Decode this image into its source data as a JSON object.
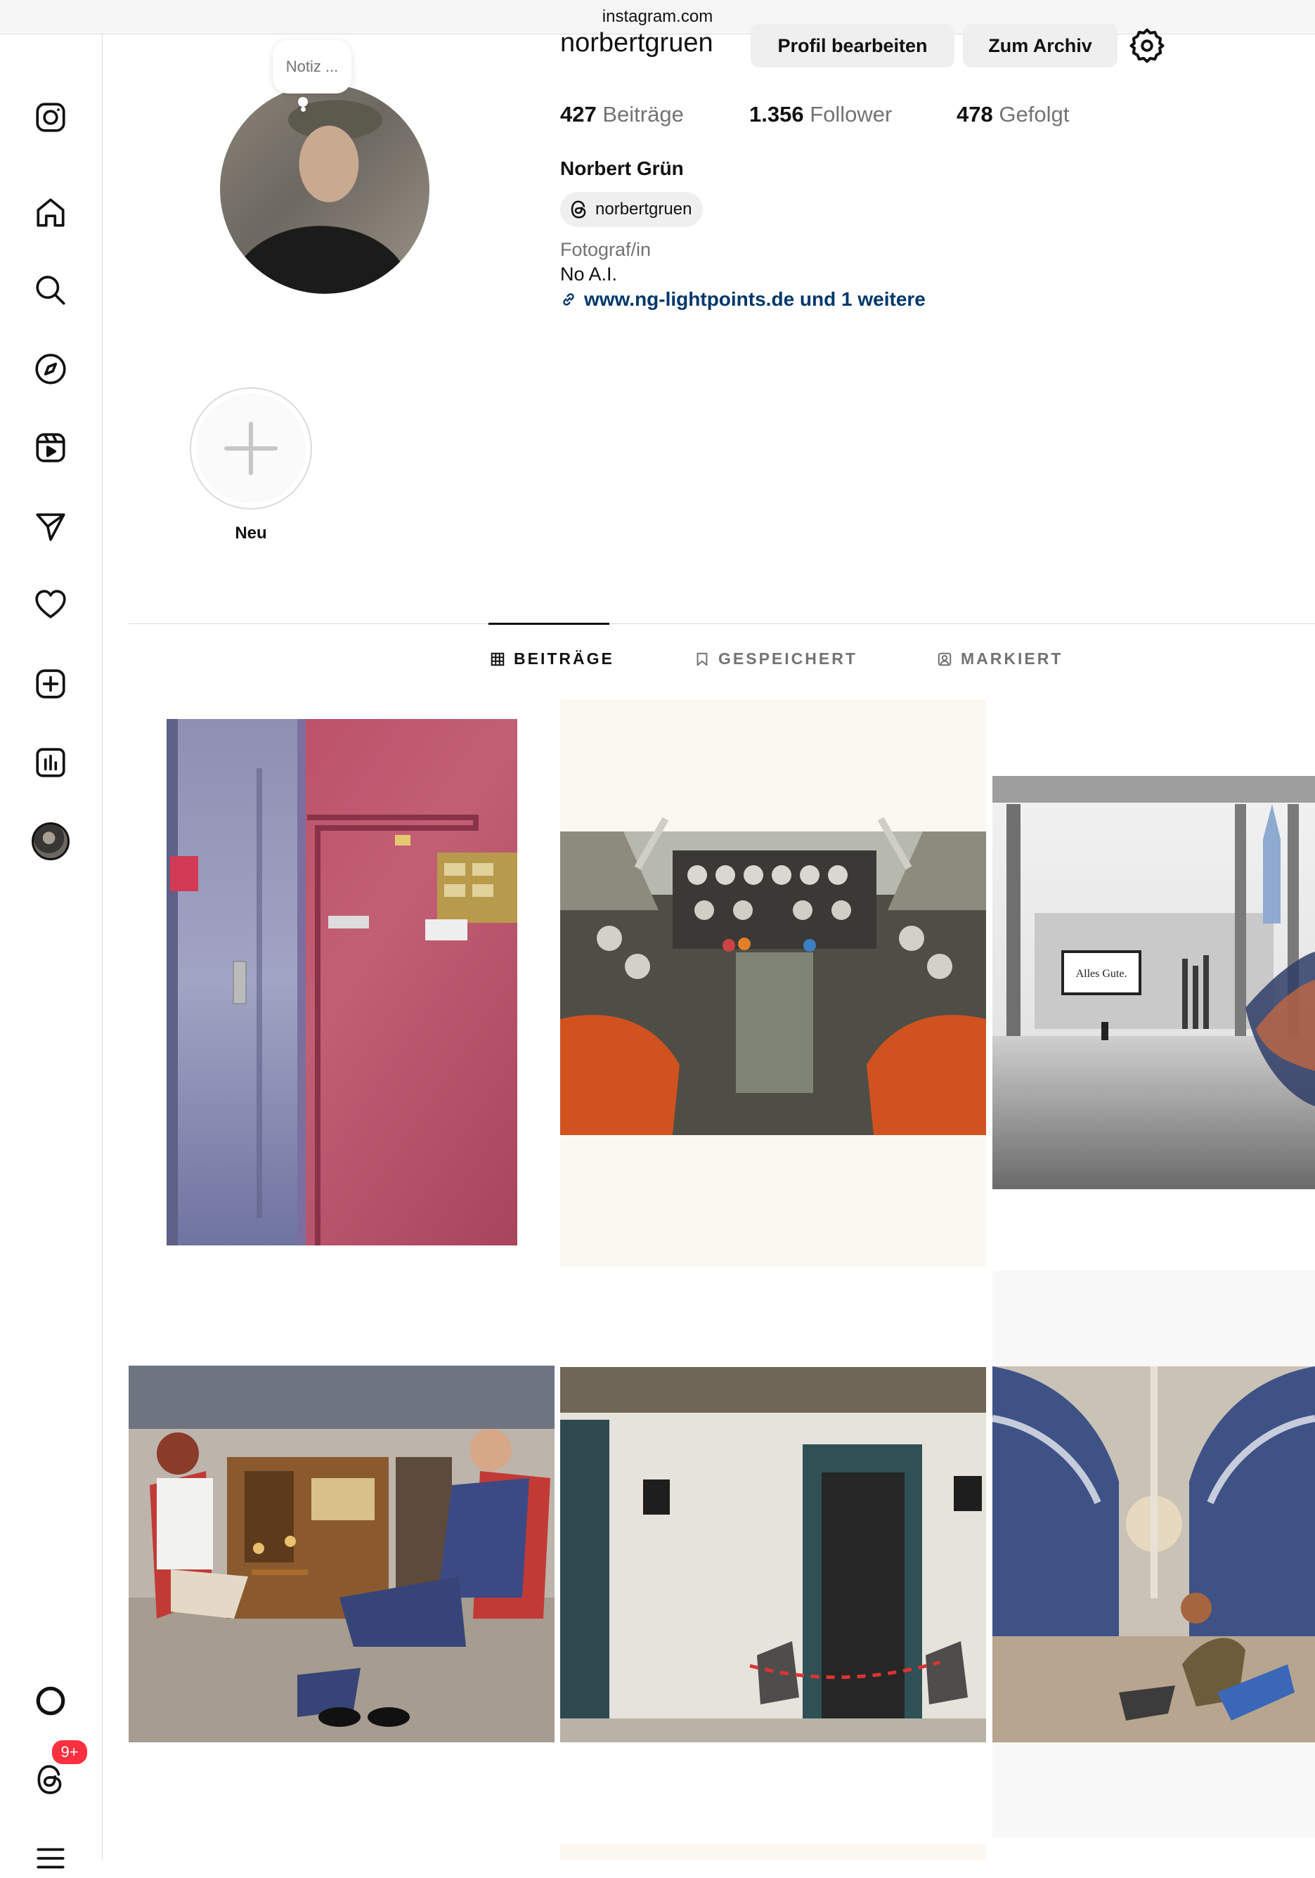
{
  "browser": {
    "url": "instagram.com"
  },
  "profile": {
    "username": "norbertgruen",
    "edit_profile_label": "Profil bearbeiten",
    "archive_label": "Zum Archiv",
    "note_placeholder": "Notiz ...",
    "stats": {
      "posts_count": "427",
      "posts_label": "Beiträge",
      "followers_count": "1.356",
      "followers_label": "Follower",
      "following_count": "478",
      "following_label": "Gefolgt"
    },
    "full_name": "Norbert Grün",
    "threads_handle": "norbertgruen",
    "category": "Fotograf/in",
    "bio": "No A.I.",
    "link_text": "www.ng-lightpoints.de und 1 weitere"
  },
  "highlights": {
    "new_label": "Neu"
  },
  "tabs": {
    "posts": "BEITRÄGE",
    "saved": "GESPEICHERT",
    "tagged": "MARKIERT"
  },
  "notifications": {
    "threads_badge": "9+"
  },
  "grid": {
    "sign_text": "Alles Gute."
  },
  "sidebar": {
    "icons": [
      "instagram-logo-icon",
      "home-icon",
      "search-icon",
      "compass-icon",
      "reels-icon",
      "direct-message-icon",
      "heart-icon",
      "create-icon",
      "insights-icon",
      "profile-avatar",
      "meta-ring-icon",
      "threads-icon",
      "menu-icon"
    ]
  }
}
